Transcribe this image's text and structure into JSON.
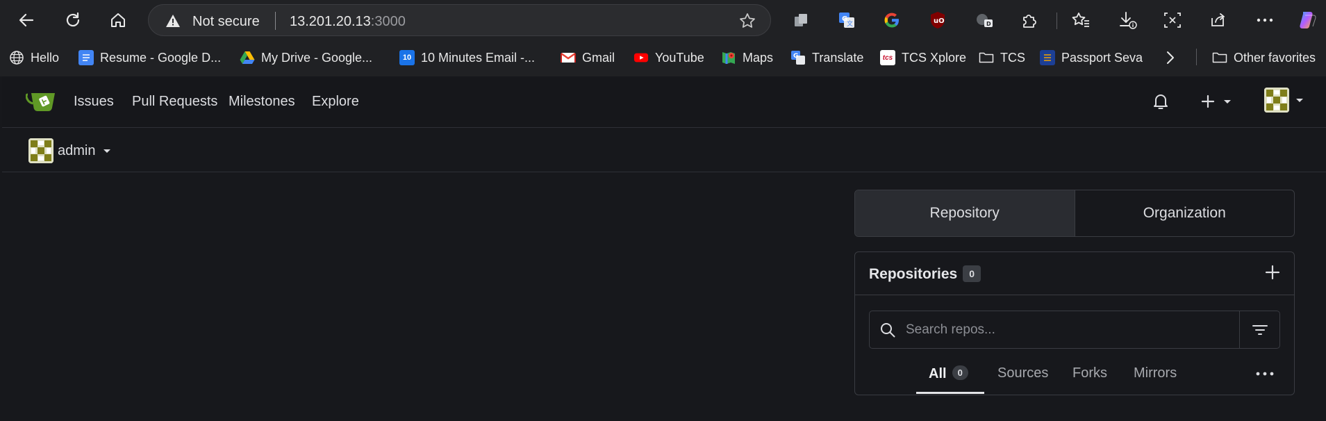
{
  "browser": {
    "address": {
      "security_label": "Not secure",
      "host": "13.201.20.13",
      "port": ":3000"
    },
    "bookmarks": [
      {
        "label": "Hello",
        "icon": "globe-icon"
      },
      {
        "label": "Resume - Google D...",
        "icon": "google-docs-icon"
      },
      {
        "label": "My Drive - Google...",
        "icon": "google-drive-icon"
      },
      {
        "label": "10 Minutes Email -...",
        "icon": "ten-minute-mail-icon"
      },
      {
        "label": "Gmail",
        "icon": "gmail-icon"
      },
      {
        "label": "YouTube",
        "icon": "youtube-icon"
      },
      {
        "label": "Maps",
        "icon": "google-maps-icon"
      },
      {
        "label": "Translate",
        "icon": "google-translate-icon"
      },
      {
        "label": "TCS Xplore",
        "icon": "tcs-icon"
      },
      {
        "label": "TCS",
        "icon": "folder-icon"
      },
      {
        "label": "Passport Seva",
        "icon": "passport-seva-icon"
      }
    ],
    "other_favorites": "Other favorites"
  },
  "app": {
    "nav": {
      "issues": "Issues",
      "pull_requests": "Pull Requests",
      "milestones": "Milestones",
      "explore": "Explore"
    },
    "context_user": "admin",
    "switcher": {
      "repository": "Repository",
      "organization": "Organization"
    },
    "repos": {
      "title": "Repositories",
      "count": "0",
      "search_placeholder": "Search repos...",
      "tabs": {
        "all": "All",
        "all_count": "0",
        "sources": "Sources",
        "forks": "Forks",
        "mirrors": "Mirrors"
      }
    }
  },
  "colors": {
    "browser_bg": "#202124",
    "app_bg": "#17181c",
    "gitea_green": "#609926",
    "border": "#3a3c42"
  }
}
